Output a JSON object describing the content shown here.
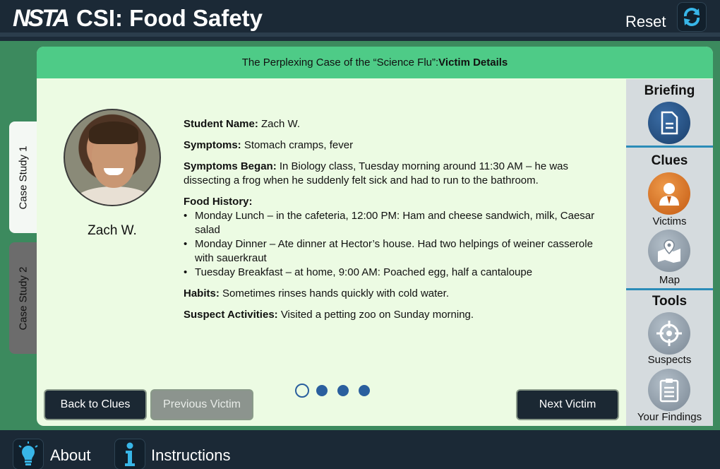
{
  "header": {
    "logo_text": "NSTA",
    "app_title": "CSI: Food Safety",
    "reset_label": "Reset"
  },
  "case_tabs": [
    {
      "label": "Case Study 1",
      "active": true
    },
    {
      "label": "Case Study 2",
      "active": false
    }
  ],
  "panel": {
    "title_prefix": "The Perplexing Case of the “Science Flu”: ",
    "title_section": "Victim Details"
  },
  "victim": {
    "name": "Zach W.",
    "student_name_label": "Student Name:",
    "student_name": "Zach W.",
    "symptoms_label": "Symptoms:",
    "symptoms": "Stomach cramps, fever",
    "symptoms_began_label": "Symptoms Began:",
    "symptoms_began": "In Biology class, Tuesday morning around 11:30 AM – he was dissecting a frog when he suddenly felt sick and had to run to the bathroom.",
    "food_history_label": "Food History:",
    "food_history": [
      "Monday Lunch – in the cafeteria, 12:00 PM: Ham and cheese sandwich, milk, Caesar salad",
      "Monday Dinner – Ate dinner at Hector’s house. Had two helpings of weiner casserole with sauerkraut",
      "Tuesday Breakfast – at home, 9:00 AM: Poached egg, half a cantaloupe"
    ],
    "habits_label": "Habits:",
    "habits": "Sometimes rinses hands quickly with cold water.",
    "suspect_activities_label": "Suspect Activities:",
    "suspect_activities": "Visited a petting zoo on Sunday morning."
  },
  "buttons": {
    "back": "Back to Clues",
    "previous": "Previous Victim",
    "next": "Next Victim"
  },
  "pagination": {
    "total": 4,
    "current": 1
  },
  "sidebar": {
    "briefing_heading": "Briefing",
    "clues_heading": "Clues",
    "victims_label": "Victims",
    "map_label": "Map",
    "tools_heading": "Tools",
    "suspects_label": "Suspects",
    "findings_label": "Your Findings"
  },
  "footer": {
    "about_label": "About",
    "instructions_label": "Instructions"
  },
  "colors": {
    "header_bg": "#1b2936",
    "stage_green": "#3c8a5e",
    "panel_header_green": "#4ecb87",
    "panel_bg": "#ecfbe3",
    "accent_blue": "#2b8cb8",
    "dot_blue": "#2a5f9e"
  }
}
